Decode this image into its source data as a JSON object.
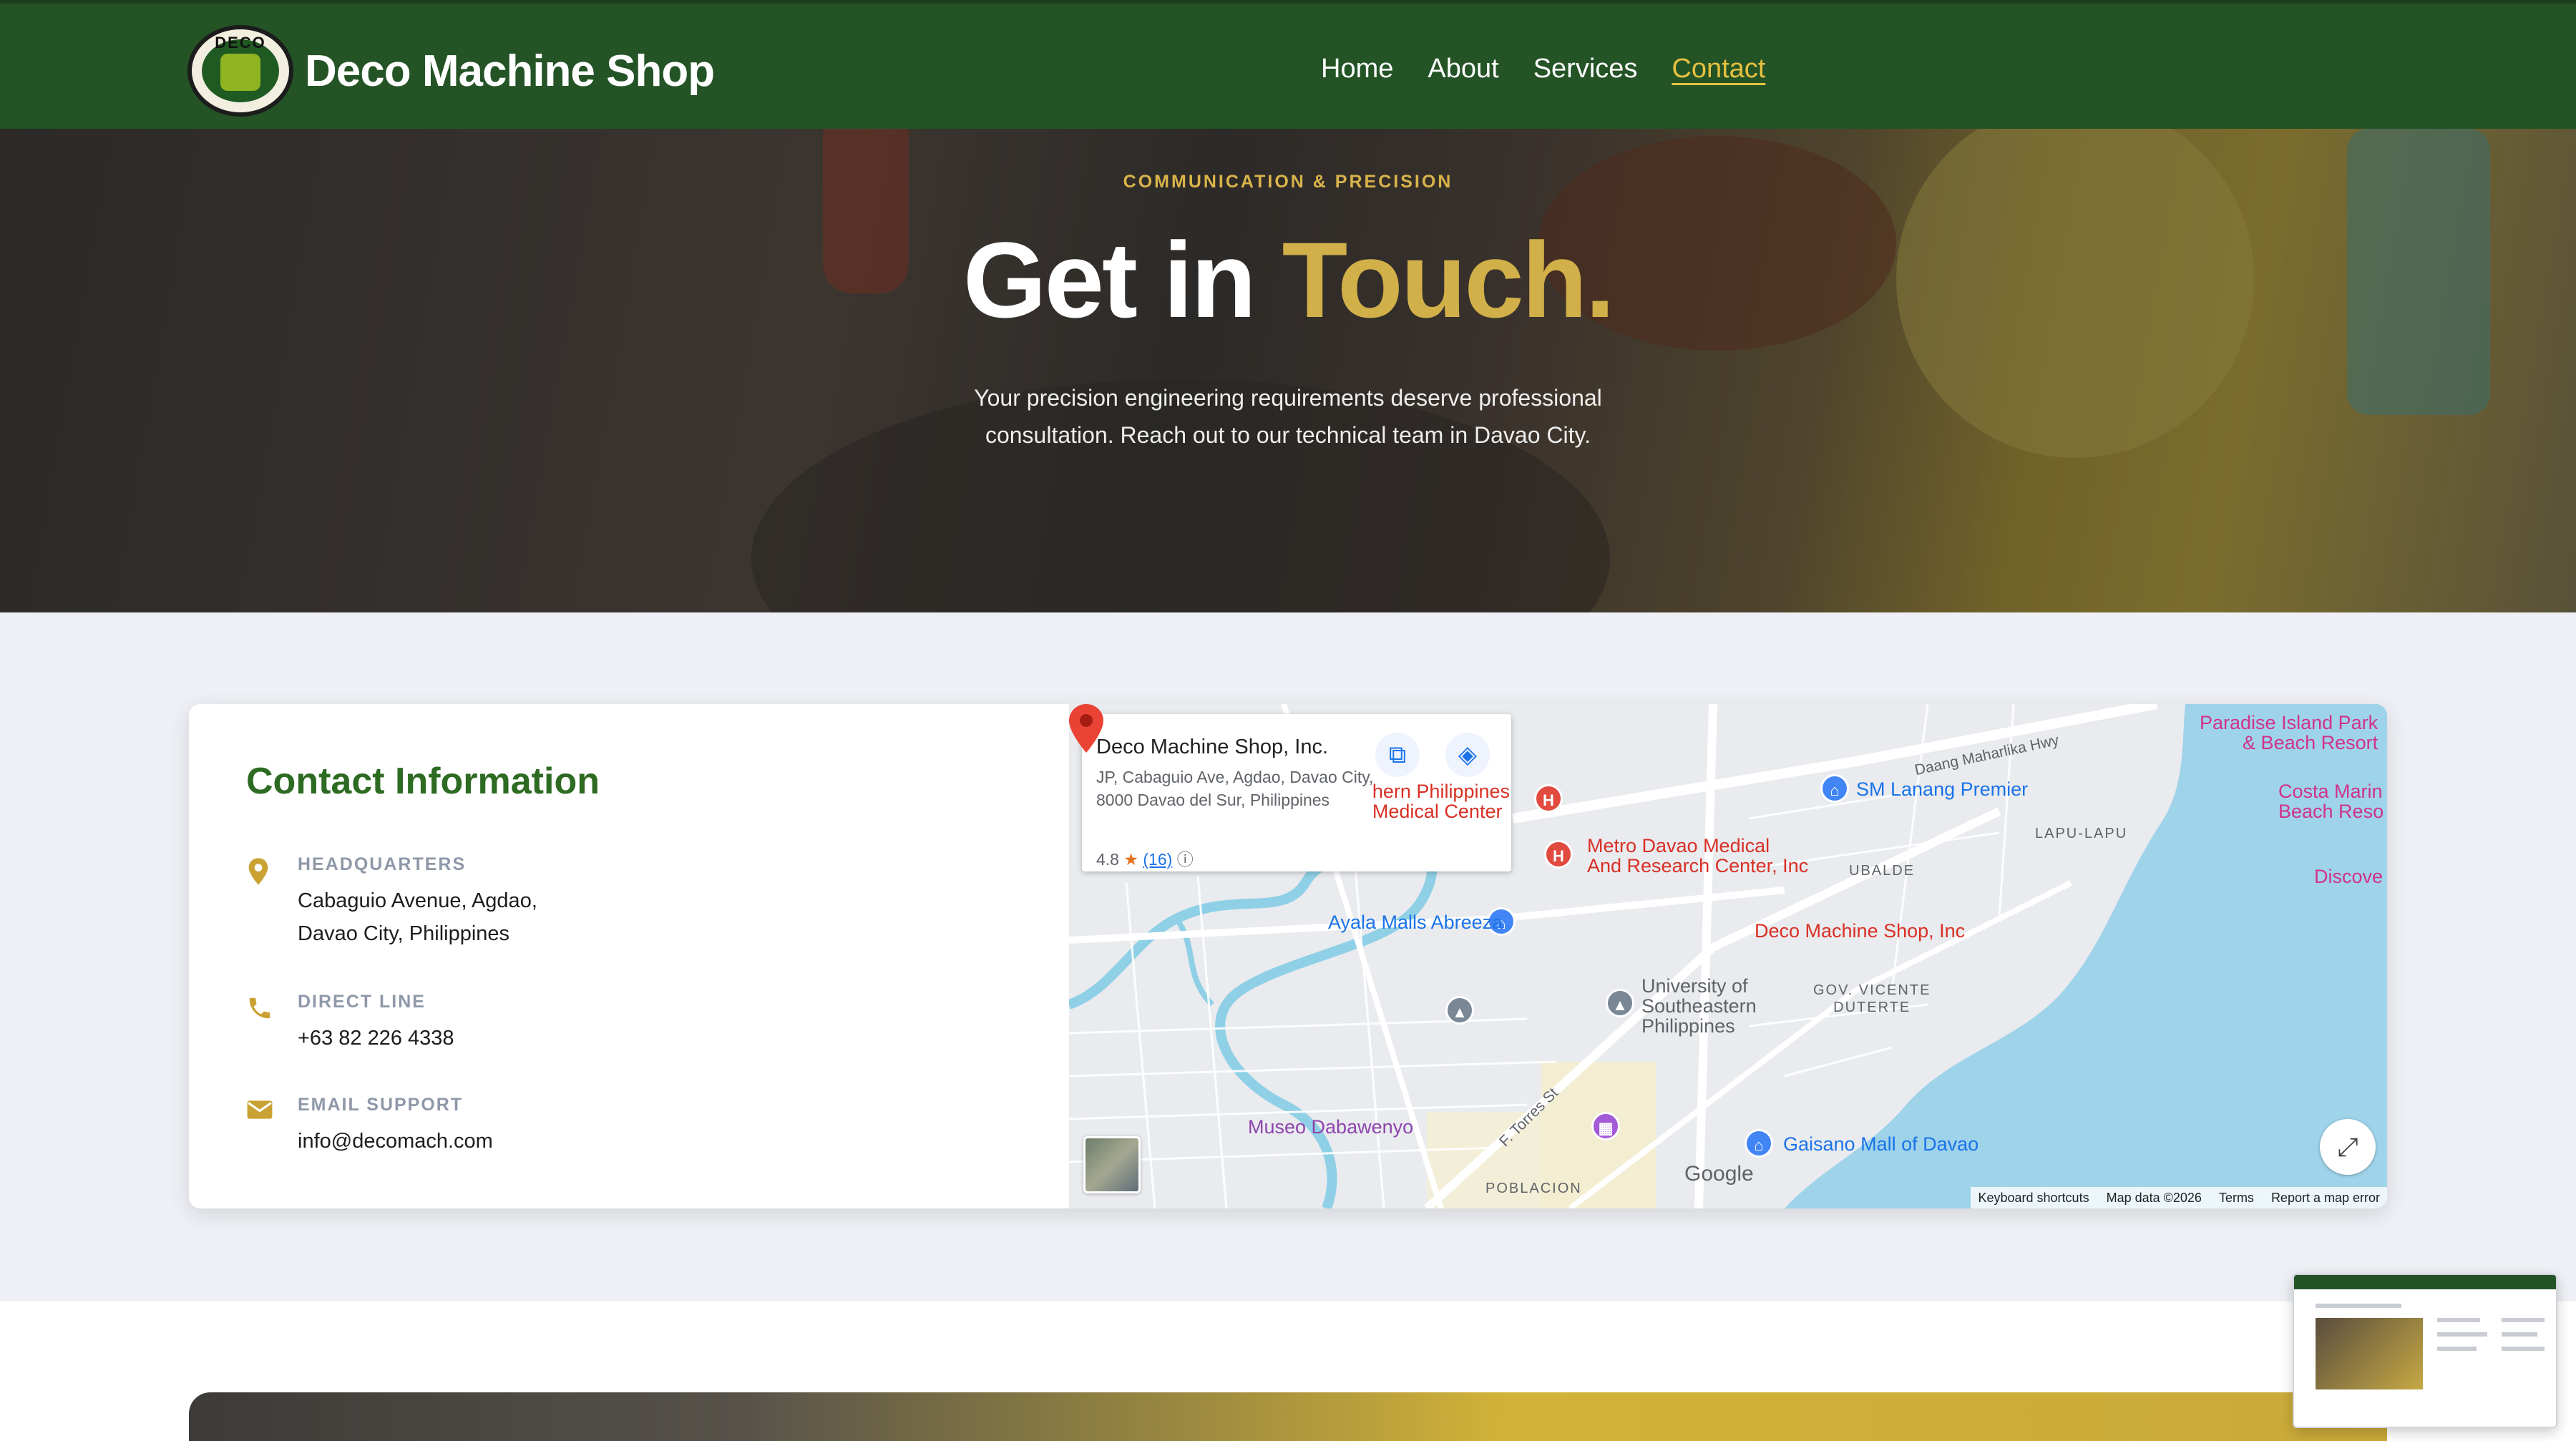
{
  "brand": {
    "name": "Deco Machine Shop",
    "logo_text": "DECO"
  },
  "nav": {
    "items": [
      {
        "label": "Home"
      },
      {
        "label": "About"
      },
      {
        "label": "Services"
      },
      {
        "label": "Contact",
        "active": true
      }
    ]
  },
  "hero": {
    "eyebrow": "COMMUNICATION & PRECISION",
    "title_main": "Get in ",
    "title_accent": "Touch.",
    "subtitle": "Your precision engineering requirements deserve professional consultation. Reach out to our technical team in Davao City."
  },
  "contact": {
    "title": "Contact Information",
    "headquarters": {
      "label": "HEADQUARTERS",
      "value": "Cabaguio Avenue, Agdao,\nDavao City, Philippines",
      "icon": "map-pin-icon"
    },
    "phone": {
      "label": "DIRECT LINE",
      "value": "+63 82 226 4338",
      "icon": "phone-icon"
    },
    "email": {
      "label": "EMAIL SUPPORT",
      "value": "info@decomach.com",
      "icon": "mail-icon"
    }
  },
  "map": {
    "place_name": "Deco Machine Shop, Inc.",
    "place_address": "JP, Cabaguio Ave, Agdao, Davao City, 8000 Davao del Sur, Philippines",
    "rating": "4.8",
    "review_count": "(16)",
    "labels": {
      "southern_ph": "hern Philippines\nMedical Center",
      "metro_davao": "Metro Davao Medical\nAnd Research Center, Inc",
      "sm_lanang": "SM Lanang Premier",
      "paradise": "Paradise Island Park\n& Beach Resort",
      "costa": "Costa Marin\nBeach Reso",
      "discove": "Discove",
      "daang": "Daang Maharlika Hwy",
      "lapu": "LAPU-LAPU",
      "ubalde": "UBALDE",
      "ayala": "Ayala Malls Abreeza",
      "deco_marker": "Deco Machine Shop, Inc",
      "usep": "University of\nSoutheastern\nPhilippines",
      "gov": "GOV. VICENTE\nDUTERTE",
      "museo": "Museo Dabawenyo",
      "torres": "F. Torres St",
      "gaisano": "Gaisano Mall of Davao",
      "poblacion": "POBLACION",
      "google": "Google"
    },
    "attribution": [
      "Keyboard shortcuts",
      "Map data ©2026",
      "Terms",
      "Report a map error"
    ]
  }
}
